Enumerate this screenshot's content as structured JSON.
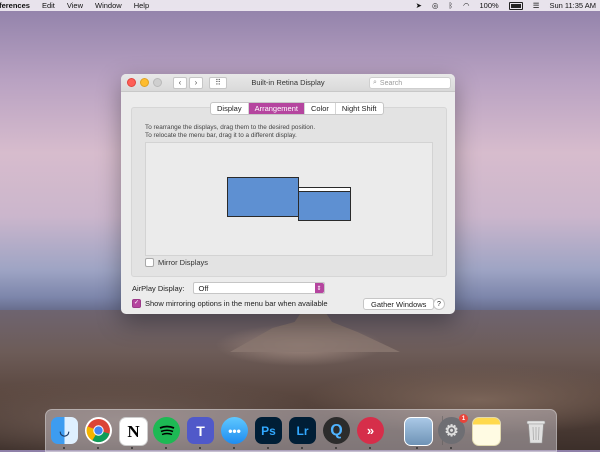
{
  "menubar": {
    "app_name": "references",
    "items": [
      "Edit",
      "View",
      "Window",
      "Help"
    ],
    "battery": "100%",
    "clock": "Sun 11:35 AM"
  },
  "window": {
    "title": "Built-in Retina Display",
    "search_placeholder": "Search",
    "tabs": [
      {
        "label": "Display",
        "active": false
      },
      {
        "label": "Arrangement",
        "active": true
      },
      {
        "label": "Color",
        "active": false
      },
      {
        "label": "Night Shift",
        "active": false
      }
    ],
    "instructions_line1": "To rearrange the displays, drag them to the desired position.",
    "instructions_line2": "To relocate the menu bar, drag it to a different display.",
    "mirror_label": "Mirror Displays",
    "airplay_label": "AirPlay Display:",
    "airplay_value": "Off",
    "show_mirroring_label": "Show mirroring options in the menu bar when available",
    "gather_label": "Gather Windows",
    "help_label": "?"
  },
  "colors": {
    "accent": "#b5459f",
    "display_blue": "#5e90d2"
  },
  "dock": {
    "badge_count": "1",
    "apps": [
      "finder-icon",
      "chrome-icon",
      "notion-icon",
      "spotify-icon",
      "teams-icon",
      "messages-icon",
      "photoshop-icon",
      "lightroom-icon",
      "quicktime-icon",
      "screenflick-icon",
      "preview-icon",
      "system-preferences-icon",
      "notes-icon",
      "trash-icon"
    ]
  }
}
